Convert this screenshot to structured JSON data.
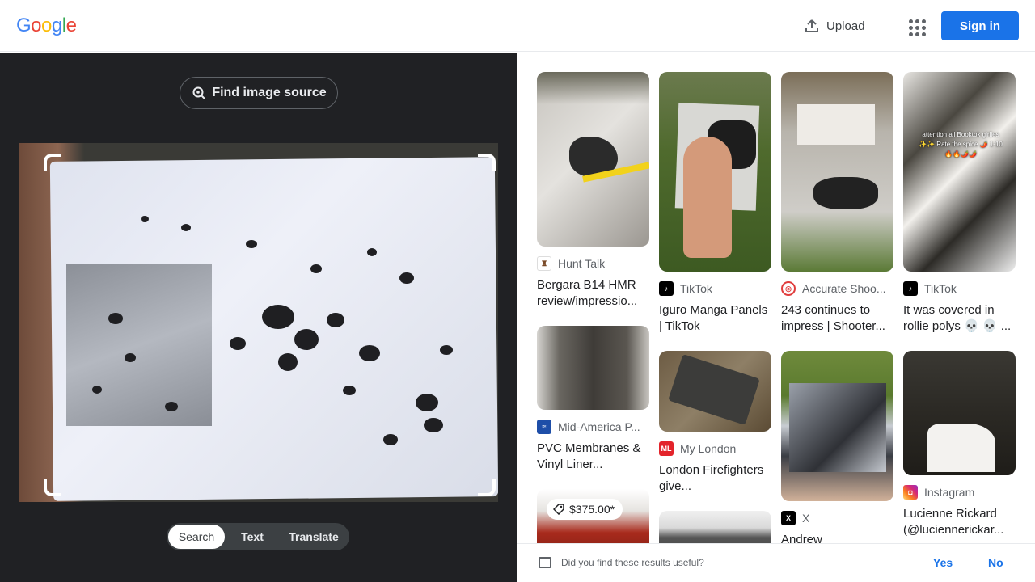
{
  "header": {
    "logo_letters": [
      "G",
      "o",
      "o",
      "g",
      "l",
      "e"
    ],
    "logo_colors": [
      "#4285f4",
      "#ea4335",
      "#fbbc05",
      "#4285f4",
      "#34a853",
      "#ea4335"
    ],
    "upload_label": "Upload",
    "signin_label": "Sign in"
  },
  "left_panel": {
    "find_source_label": "Find image source",
    "tabs": [
      {
        "label": "Search",
        "active": true
      },
      {
        "label": "Text",
        "active": false
      },
      {
        "label": "Translate",
        "active": false
      }
    ]
  },
  "results": {
    "columns": [
      [
        {
          "source": "Hunt Talk",
          "favicon_color": "#ffffff",
          "favicon_text": "♜",
          "title": "Bergara B14 HMR review/impressio...",
          "thumb_style": "target"
        },
        {
          "source": "Mid-America P...",
          "favicon_color": "#1e4ea8",
          "favicon_text": "≈",
          "title": "PVC Membranes & Vinyl Liner...",
          "thumb_style": "dark"
        },
        {
          "price": "$375.00*",
          "thumb_style": "red"
        }
      ],
      [
        {
          "source": "TikTok",
          "favicon_color": "#000000",
          "favicon_text": "♪",
          "title": "Iguro Manga Panels | TikTok",
          "thumb_style": "hand"
        },
        {
          "source": "My London",
          "favicon_color": "#e3242b",
          "favicon_text": "ML",
          "title": "London Firefighters give...",
          "thumb_style": "burnt"
        },
        {
          "thumb_style": "gray"
        }
      ],
      [
        {
          "source": "Accurate Shoo...",
          "favicon_color": "#e03c3c",
          "favicon_text": "◎",
          "title": "243 continues to impress | Shooter...",
          "thumb_style": "target2"
        },
        {
          "source": "X",
          "favicon_color": "#000000",
          "favicon_text": "X",
          "title": "Andrew",
          "thumb_style": "board"
        }
      ],
      [
        {
          "source": "TikTok",
          "favicon_color": "#000000",
          "favicon_text": "♪",
          "title": "It was covered in rollie polys 💀 💀 ...",
          "thumb_style": "peel",
          "overlay": "attention all Booktok girlies ✨✨ Rate the spice 🌶️ 1-10 🔥🔥🌶️🌶️"
        },
        {
          "source": "Instagram",
          "favicon_color": "#d62976",
          "favicon_text": "◘",
          "title": "Lucienne Rickard (@luciennerickar...",
          "thumb_style": "black"
        }
      ]
    ]
  },
  "feedback": {
    "question": "Did you find these results useful?",
    "yes_label": "Yes",
    "no_label": "No"
  }
}
